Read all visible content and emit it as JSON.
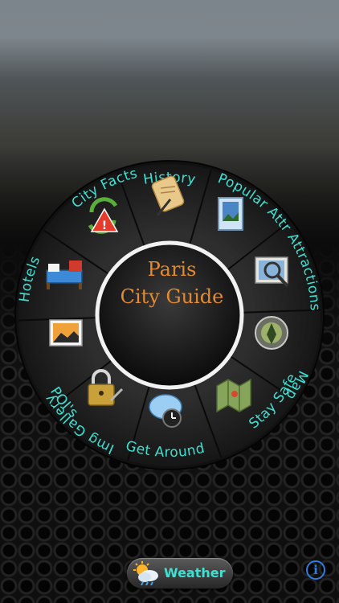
{
  "app": {
    "center_title_line1": "Paris",
    "center_title_line2": "City Guide"
  },
  "menu": [
    {
      "label": "History",
      "icon": "scroll-quill-icon"
    },
    {
      "label": "Popular Attr Attractions",
      "icon": "picture-frame-icon"
    },
    {
      "label": "Map",
      "icon": "magnifier-map-icon"
    },
    {
      "label": "POI's",
      "icon": "compass-pin-icon"
    },
    {
      "label": "Get Around",
      "icon": "folded-map-icon"
    },
    {
      "label": "Stay Safe",
      "icon": "chat-clock-icon"
    },
    {
      "label": "Img Gallery",
      "icon": "padlock-key-icon"
    },
    {
      "label": "Hotels",
      "icon": "photo-icon"
    },
    {
      "label": "City Facts",
      "icon": "bed-icon"
    }
  ],
  "footer": {
    "weather_label": "Weather",
    "info_label": "i"
  },
  "colors": {
    "label": "#3fe0d2",
    "title": "#e58a2e",
    "info": "#2f7de0"
  }
}
